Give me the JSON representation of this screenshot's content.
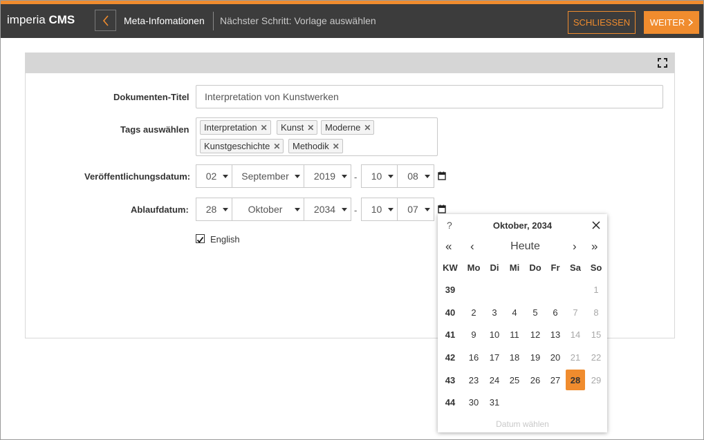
{
  "header": {
    "brand_light": "imperia",
    "brand_bold": "CMS",
    "title": "Meta-Infomationen",
    "next_step": "Nächster Schritt: Vorlage auswählen",
    "close_label": "SCHLIESSEN",
    "next_label": "WEITER",
    "accent_color": "#f08c2e"
  },
  "form": {
    "doc_title_label": "Dokumenten-Titel",
    "doc_title_value": "Interpretation von Kunstwerken",
    "tags_label": "Tags auswählen",
    "tags": [
      "Interpretation",
      "Kunst",
      "Moderne",
      "Kunstgeschichte",
      "Methodik"
    ],
    "pub_label": "Veröffentlichungsdatum:",
    "pub": {
      "day": "02",
      "month": "September",
      "year": "2019",
      "hour": "10",
      "minute": "08"
    },
    "exp_label": "Ablaufdatum:",
    "exp": {
      "day": "28",
      "month": "Oktober",
      "year": "2034",
      "hour": "10",
      "minute": "07"
    },
    "dash": "-",
    "english_label": "English",
    "english_checked": true
  },
  "calendar": {
    "help": "?",
    "title": "Oktober, 2034",
    "today_label": "Heute",
    "nav_prev_year": "«",
    "nav_prev": "‹",
    "nav_next": "›",
    "nav_next_year": "»",
    "weekday_headers": [
      "KW",
      "Mo",
      "Di",
      "Mi",
      "Do",
      "Fr",
      "Sa",
      "So"
    ],
    "weeks": [
      {
        "kw": "39",
        "days": [
          "",
          "",
          "",
          "",
          "",
          "",
          "1"
        ]
      },
      {
        "kw": "40",
        "days": [
          "2",
          "3",
          "4",
          "5",
          "6",
          "7",
          "8"
        ]
      },
      {
        "kw": "41",
        "days": [
          "9",
          "10",
          "11",
          "12",
          "13",
          "14",
          "15"
        ]
      },
      {
        "kw": "42",
        "days": [
          "16",
          "17",
          "18",
          "19",
          "20",
          "21",
          "22"
        ]
      },
      {
        "kw": "43",
        "days": [
          "23",
          "24",
          "25",
          "26",
          "27",
          "28",
          "29"
        ]
      },
      {
        "kw": "44",
        "days": [
          "30",
          "31",
          "",
          "",
          "",
          "",
          ""
        ]
      }
    ],
    "selected_day": "28",
    "footer": "Datum wählen"
  }
}
